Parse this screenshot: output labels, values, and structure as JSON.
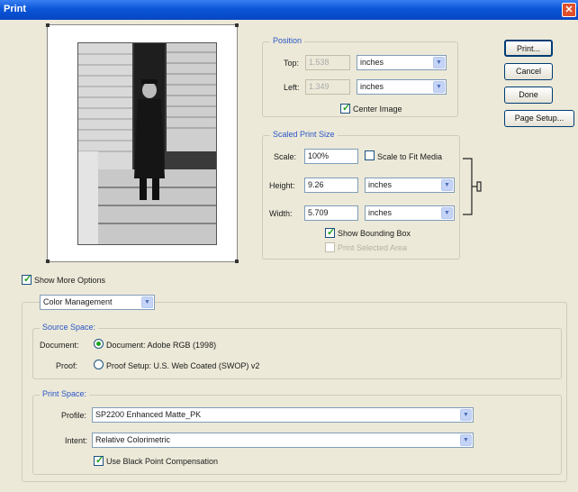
{
  "window": {
    "title": "Print"
  },
  "position": {
    "legend": "Position",
    "top_label": "Top:",
    "top_value": "1.538",
    "top_unit": "inches",
    "left_label": "Left:",
    "left_value": "1.349",
    "left_unit": "inches",
    "center_image_label": "Center Image",
    "center_image_checked": true
  },
  "scaled": {
    "legend": "Scaled Print Size",
    "scale_label": "Scale:",
    "scale_value": "100%",
    "scale_to_fit_label": "Scale to Fit Media",
    "height_label": "Height:",
    "height_value": "9.26",
    "height_unit": "inches",
    "width_label": "Width:",
    "width_value": "5.709",
    "width_unit": "inches",
    "show_bounding_box_label": "Show Bounding Box",
    "print_selected_area_label": "Print Selected Area"
  },
  "buttons": {
    "print": "Print...",
    "cancel": "Cancel",
    "done": "Done",
    "page_setup": "Page Setup..."
  },
  "more_options": {
    "label": "Show More Options",
    "dropdown_value": "Color Management"
  },
  "source_space": {
    "legend": "Source Space:",
    "document_label": "Document:",
    "document_option": "Document:  Adobe RGB (1998)",
    "proof_label": "Proof:",
    "proof_option": "Proof Setup:  U.S. Web Coated (SWOP) v2"
  },
  "print_space": {
    "legend": "Print Space:",
    "profile_label": "Profile:",
    "profile_value": "SP2200 Enhanced Matte_PK",
    "intent_label": "Intent:",
    "intent_value": "Relative Colorimetric",
    "black_point_label": "Use Black Point Compensation"
  },
  "icons": {
    "close": "close-icon",
    "dropdown": "chevron-down-icon",
    "link": "link-chain-icon"
  },
  "colors": {
    "title_bar": "#0a56d8",
    "accent_text": "#2a56c6",
    "check_mark": "#21a121"
  }
}
